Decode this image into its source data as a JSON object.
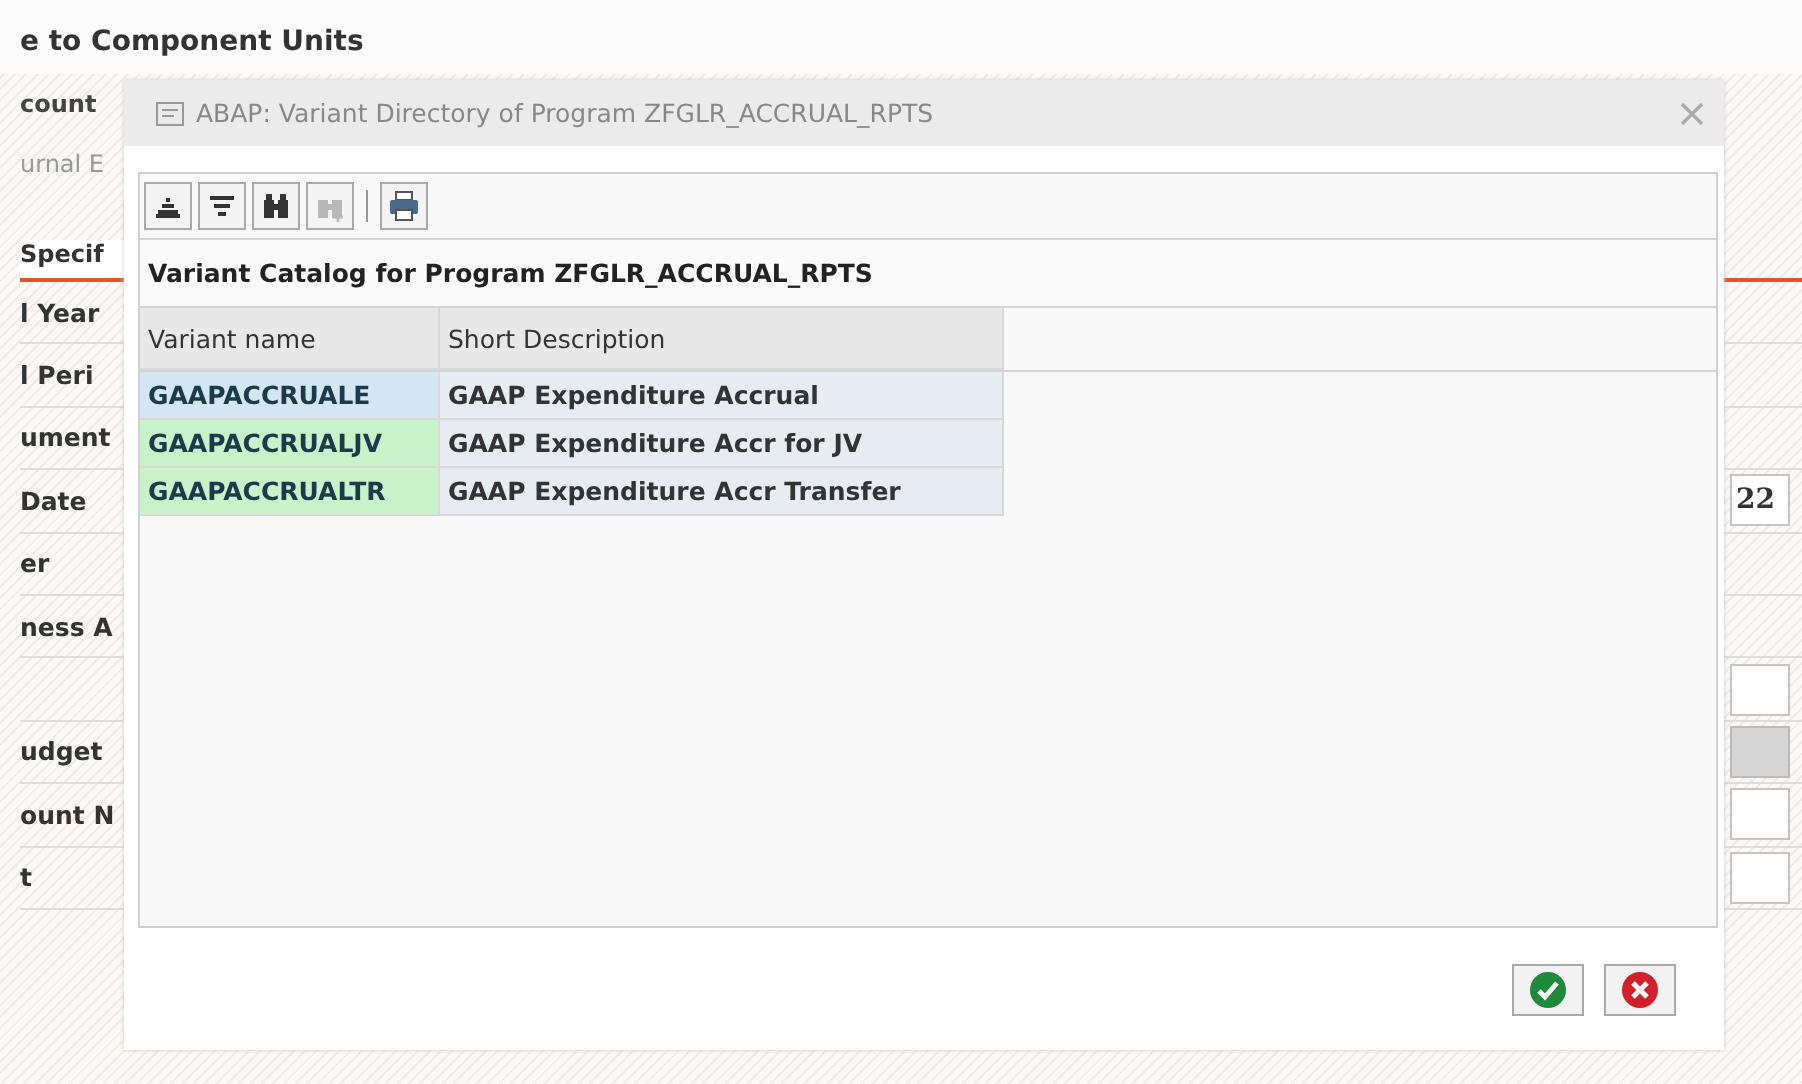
{
  "background": {
    "title": "e to Component Units",
    "header_labels": [
      {
        "text": "count",
        "kind": "label"
      },
      {
        "text": "urnal E",
        "kind": "hint"
      }
    ],
    "tab": {
      "label": "Specif",
      "selected": true
    },
    "fields": [
      {
        "kind": "label",
        "label": "l Year"
      },
      {
        "kind": "label",
        "label": "l Peri"
      },
      {
        "kind": "label",
        "label": "ument"
      },
      {
        "kind": "input",
        "label": "Date",
        "value": "22",
        "disabled": false
      },
      {
        "kind": "label",
        "label": "er"
      },
      {
        "kind": "label",
        "label": "ness A"
      },
      {
        "kind": "input",
        "disabled": false
      },
      {
        "kind": "input",
        "label": "udget",
        "disabled": true
      },
      {
        "kind": "input",
        "label": "ount N",
        "disabled": false
      },
      {
        "kind": "input",
        "label": "t",
        "disabled": false
      }
    ]
  },
  "dialog": {
    "title": "ABAP: Variant Directory of Program ZFGLR_ACCRUAL_RPTS",
    "toolbar": [
      {
        "kind": "sort",
        "disabled": false
      },
      {
        "kind": "filter",
        "disabled": false
      },
      {
        "kind": "find",
        "disabled": false
      },
      {
        "kind": "find-next",
        "disabled": true
      },
      {
        "kind": "separator"
      },
      {
        "kind": "print",
        "disabled": false
      }
    ],
    "catalog_title": "Variant Catalog for Program ZFGLR_ACCRUAL_RPTS",
    "table": {
      "columns": [
        "Variant name",
        "Short Description"
      ],
      "rows": [
        {
          "variant": "GAAPACCRUALE",
          "description": "GAAP Expenditure Accrual",
          "selected": true
        },
        {
          "variant": "GAAPACCRUALJV",
          "description": "GAAP Expenditure Accr for JV",
          "selected": false
        },
        {
          "variant": "GAAPACCRUALTR",
          "description": "GAAP Expenditure Accr Transfer",
          "selected": false
        }
      ]
    },
    "buttons": [
      {
        "kind": "confirm"
      },
      {
        "kind": "cancel"
      }
    ]
  }
}
